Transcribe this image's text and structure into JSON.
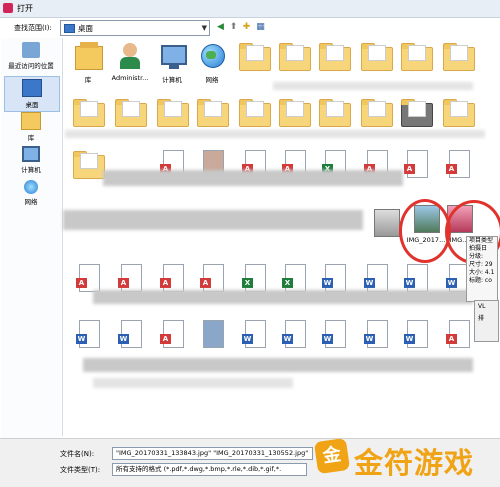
{
  "window": {
    "title": "打开"
  },
  "toolbar": {
    "look_in_label": "查找范围(I):",
    "look_in_value": "桌面",
    "back_glyph": "◀",
    "up_glyph": "⬆",
    "newfolder_glyph": "✚",
    "views_glyph": "▦"
  },
  "sidebar": {
    "items": [
      {
        "label": "最近访问的位置",
        "icon": "recent-icon"
      },
      {
        "label": "桌面",
        "icon": "desktop-icon"
      },
      {
        "label": "库",
        "icon": "library-icon"
      },
      {
        "label": "计算机",
        "icon": "computer-icon"
      },
      {
        "label": "网络",
        "icon": "network-icon"
      }
    ]
  },
  "content": {
    "top_items": [
      {
        "label": "库"
      },
      {
        "label": "Administr..."
      },
      {
        "label": "计算机"
      },
      {
        "label": "网络"
      }
    ],
    "image_items": [
      {
        "label": "IMG_2017..."
      },
      {
        "label": "IMG..."
      }
    ]
  },
  "tooltip": {
    "lines": [
      "项目类型",
      "拍摄日",
      "分级:",
      "尺寸: 29",
      "大小: 4.1",
      "标题: co"
    ]
  },
  "context_menu": {
    "items": [
      "VL",
      "排"
    ]
  },
  "footer": {
    "filename_label": "文件名(N):",
    "filename_value": "\"IMG_20170331_133843.jpg\" \"IMG_20170331_130552.jpg\"",
    "filetype_label": "文件类型(T):",
    "filetype_value": "所有支持的格式 (*.pdf,*.dwg,*.bmp,*.rle,*.dib,*.gif,*."
  },
  "watermark": {
    "brand": "金符游戏",
    "logo_glyph": "金"
  },
  "colors": {
    "highlight_circle": "#e0332e",
    "brand_orange": "#f1a316"
  }
}
